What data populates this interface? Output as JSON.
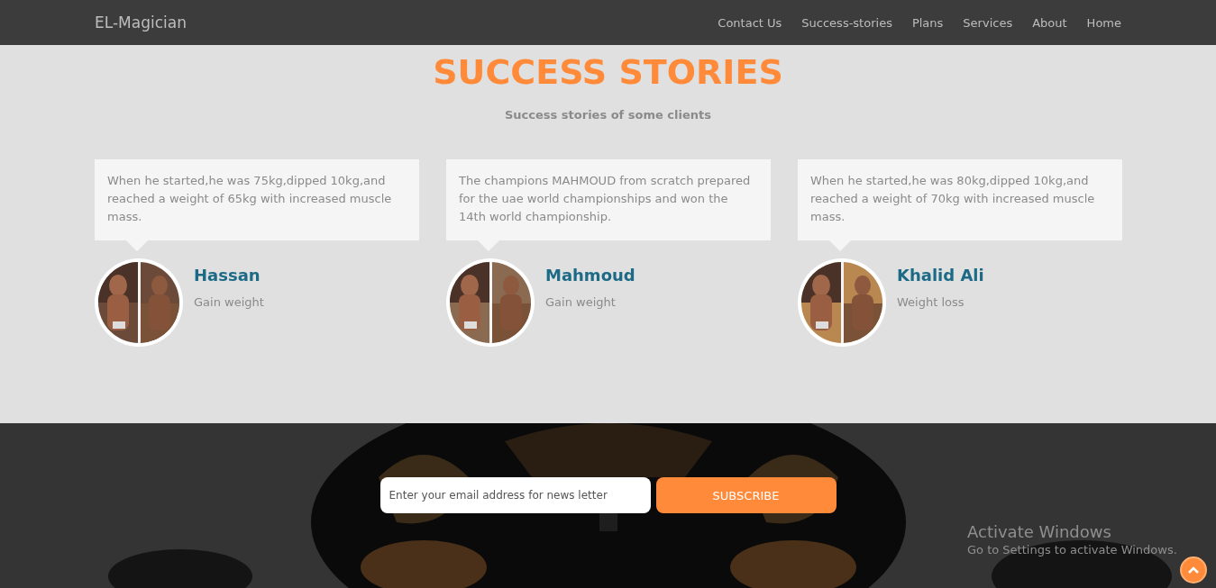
{
  "navbar": {
    "brand": "EL-Magician",
    "links": [
      {
        "label": "Contact Us"
      },
      {
        "label": "Success-stories"
      },
      {
        "label": "Plans"
      },
      {
        "label": "Services"
      },
      {
        "label": "About"
      },
      {
        "label": "Home"
      }
    ]
  },
  "section": {
    "title": "SUCCESS STORIES",
    "subtitle": "Success stories of some clients"
  },
  "stories": [
    {
      "quote": "When he started,he was 75kg,dipped 10kg,and reached a weight of 65kg with increased muscle mass.",
      "name": "Hassan",
      "goal": "Gain weight"
    },
    {
      "quote": "The champions MAHMOUD from scratch prepared for the uae world championships and won the 14th world championship.",
      "name": "Mahmoud",
      "goal": "Gain weight"
    },
    {
      "quote": "When he started,he was 80kg,dipped 10kg,and reached a weight of 70kg with increased muscle mass.",
      "name": "Khalid Ali",
      "goal": "Weight loss"
    }
  ],
  "newsletter": {
    "placeholder": "Enter your email address for news letter",
    "button": "SUBSCRIBE"
  },
  "os_notice": {
    "title": "Activate Windows",
    "text": "Go to Settings to activate Windows."
  }
}
